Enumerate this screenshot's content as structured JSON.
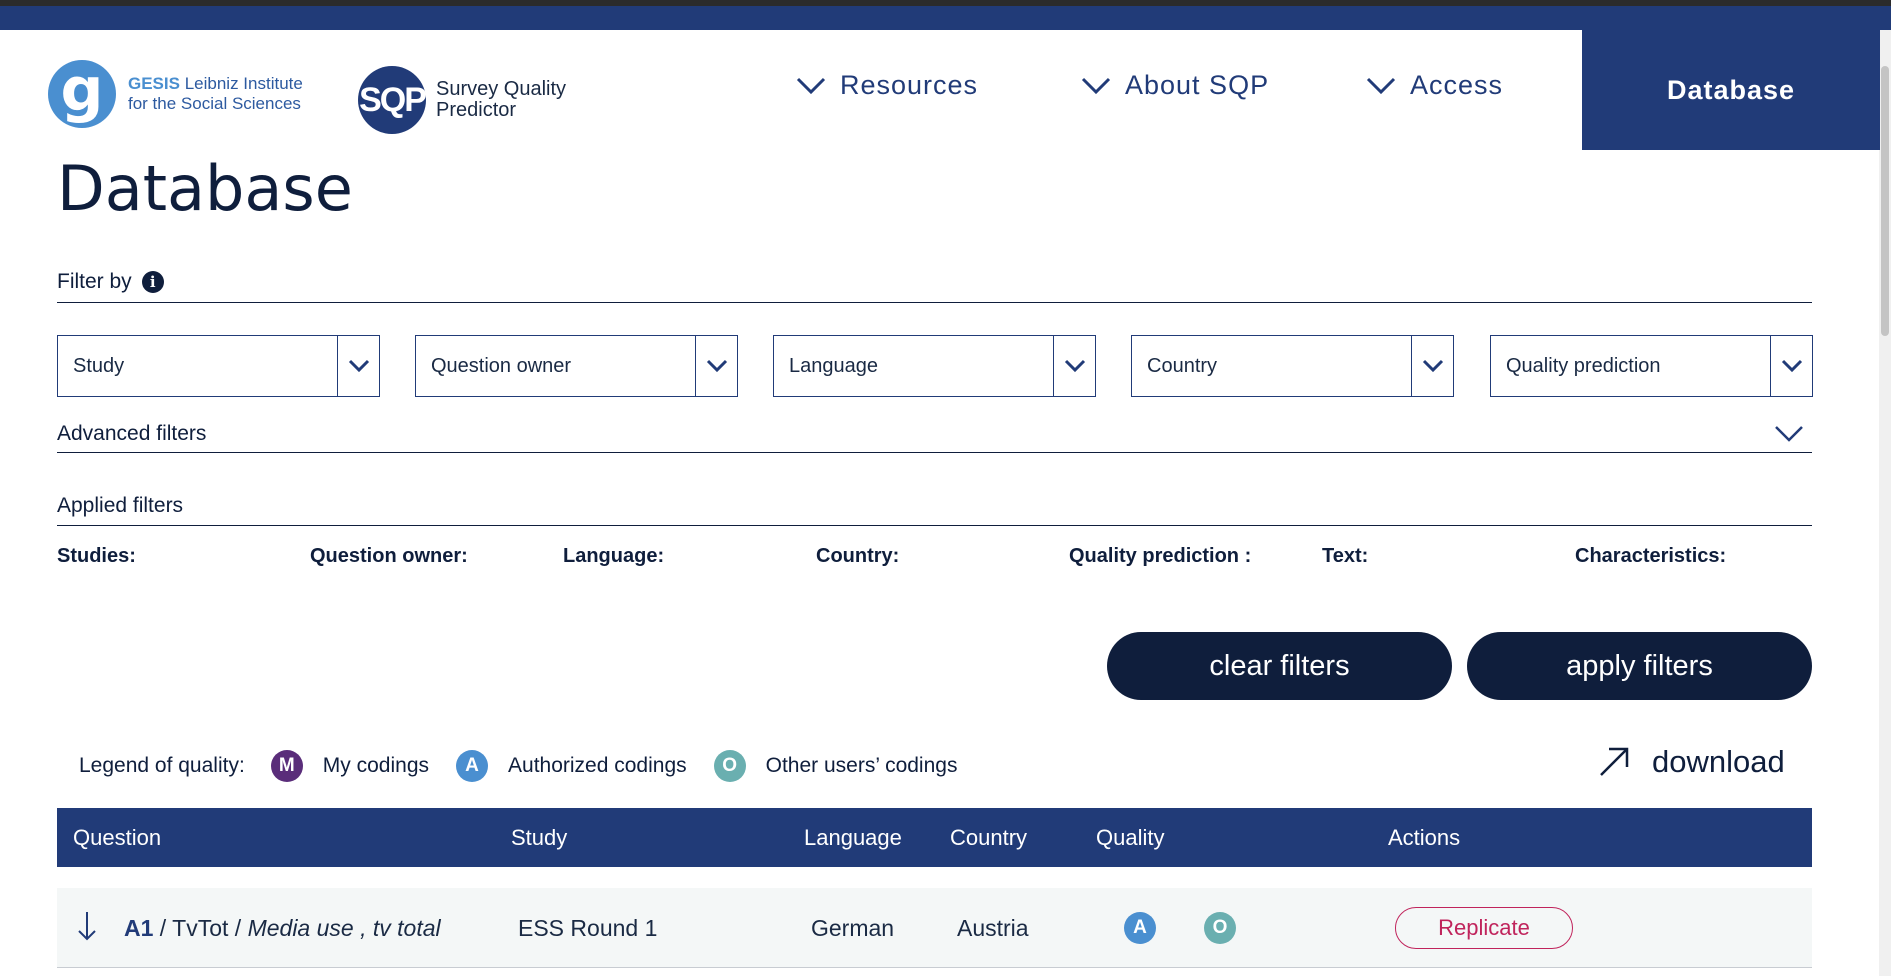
{
  "colors": {
    "brand": "#213b78",
    "dark": "#0f1e3c",
    "my": "#5a2d7a",
    "authorized": "#4a8fd0",
    "other": "#6aafb0",
    "replicate": "#c0245c"
  },
  "header": {
    "gesis_logo_letter": "g",
    "gesis_name": "GESIS",
    "gesis_line1_rest": "Leibniz Institute",
    "gesis_line2": "for the Social Sciences",
    "sqp_logo": "SQP",
    "sqp_line1": "Survey Quality",
    "sqp_line2": "Predictor",
    "nav": {
      "resources": "Resources",
      "about": "About SQP",
      "access": "Access",
      "database": "Database"
    }
  },
  "page": {
    "title": "Database"
  },
  "filters": {
    "heading": "Filter by",
    "info_glyph": "i",
    "selects": [
      "Study",
      "Question owner",
      "Language",
      "Country",
      "Quality prediction"
    ],
    "advanced": "Advanced filters",
    "applied": "Applied filters",
    "applied_labels": [
      "Studies:",
      "Question owner:",
      "Language:",
      "Country:",
      "Quality prediction :",
      "Text:",
      "Characteristics:"
    ],
    "clear": "clear filters",
    "apply": "apply filters"
  },
  "legend": {
    "title": "Legend of quality:",
    "items": [
      {
        "badge": "M",
        "label": "My codings"
      },
      {
        "badge": "A",
        "label": "Authorized codings"
      },
      {
        "badge": "O",
        "label": "Other users’ codings"
      }
    ],
    "download": "download"
  },
  "table": {
    "columns": [
      "Question",
      "Study",
      "Language",
      "Country",
      "Quality",
      "Actions"
    ],
    "rows": [
      {
        "code": "A1",
        "sep1": " / ",
        "name": "TvTot",
        "sep2": " / ",
        "description": "Media use , tv total",
        "study": "ESS Round 1",
        "language": "German",
        "country": "Austria",
        "quality_badges": [
          "A",
          "O"
        ],
        "action": "Replicate"
      }
    ]
  }
}
